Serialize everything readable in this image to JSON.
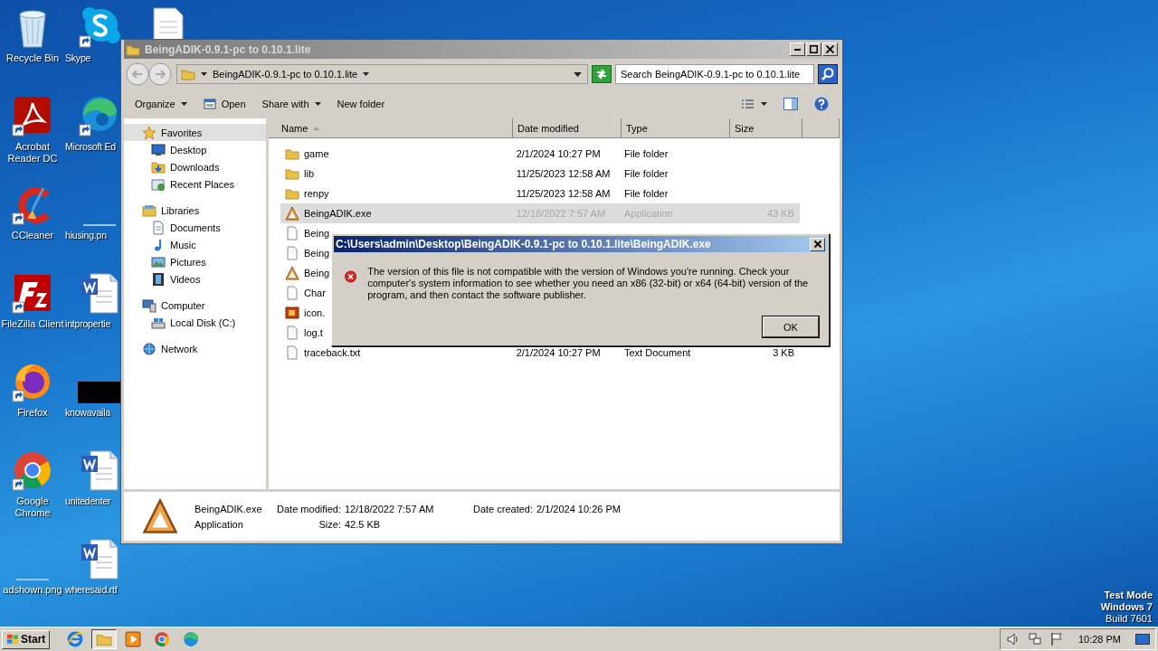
{
  "desktop": {
    "icons": [
      {
        "label": "Recycle Bin",
        "kind": "recycle",
        "shortcut": false
      },
      {
        "label": "Acrobat Reader DC",
        "kind": "acrobat",
        "shortcut": true
      },
      {
        "label": "CCleaner",
        "kind": "ccleaner",
        "shortcut": true
      },
      {
        "label": "FileZilla Client",
        "kind": "filezilla",
        "shortcut": true
      },
      {
        "label": "Firefox",
        "kind": "firefox",
        "shortcut": true
      },
      {
        "label": "Google Chrome",
        "kind": "chrome",
        "shortcut": true
      },
      {
        "label": "adshown.png",
        "kind": "blank"
      },
      {
        "label": "Skype",
        "kind": "skype",
        "shortcut": true
      },
      {
        "label": "Microsoft Ed",
        "kind": "edge",
        "shortcut": true
      },
      {
        "label": "hiusing.pn",
        "kind": "blank"
      },
      {
        "label": "intpropertie",
        "kind": "word",
        "shortcut": false
      },
      {
        "label": "knowavaila",
        "kind": "black"
      },
      {
        "label": "unitedenter",
        "kind": "word",
        "shortcut": false
      },
      {
        "label": "wheresaid.rtf",
        "kind": "word",
        "shortcut": false
      },
      {
        "kind": "page",
        "shortcut": false
      }
    ],
    "mode_text": [
      "Test Mode",
      "Windows 7",
      "Build 7601"
    ]
  },
  "explorer": {
    "title": "BeingADIK-0.9.1-pc to 0.10.1.lite",
    "active": false,
    "address": "BeingADIK-0.9.1-pc to 0.10.1.lite",
    "search": {
      "placeholder": "Search BeingADIK-0.9.1-pc to 0.10.1.lite"
    },
    "commands": [
      {
        "label": "Organize",
        "kind": "menu"
      },
      {
        "label": "Open",
        "kind": "open"
      },
      {
        "label": "Share with",
        "kind": "menu"
      },
      {
        "label": "New folder",
        "kind": "plain"
      }
    ],
    "nav": [
      {
        "label": "Favorites",
        "kind": "star",
        "selected": true,
        "children": [
          {
            "label": "Desktop",
            "kind": "desktop",
            "selected": false
          },
          {
            "label": "Downloads",
            "kind": "downloads",
            "selected": false
          },
          {
            "label": "Recent Places",
            "kind": "recent",
            "selected": false
          }
        ]
      },
      {
        "label": "Libraries",
        "kind": "library",
        "selected": false,
        "children": [
          {
            "label": "Documents",
            "kind": "documents",
            "selected": false
          },
          {
            "label": "Music",
            "kind": "music",
            "selected": false
          },
          {
            "label": "Pictures",
            "kind": "pictures",
            "selected": false
          },
          {
            "label": "Videos",
            "kind": "videos",
            "selected": false
          }
        ]
      },
      {
        "label": "Computer",
        "kind": "computer",
        "selected": false,
        "children": [
          {
            "label": "Local Disk (C:)",
            "kind": "disk",
            "selected": false
          }
        ]
      },
      {
        "label": "Network",
        "kind": "network",
        "selected": false
      }
    ],
    "columns": [
      "Name",
      "Date modified",
      "Type",
      "Size"
    ],
    "rows": [
      {
        "name": "game",
        "date_modified": "2/1/2024 10:27 PM",
        "type": "File folder",
        "kind": "folder",
        "selected": false
      },
      {
        "name": "lib",
        "date_modified": "11/25/2023 12:58 AM",
        "type": "File folder",
        "kind": "folder",
        "selected": false
      },
      {
        "name": "renpy",
        "date_modified": "11/25/2023 12:58 AM",
        "type": "File folder",
        "kind": "folder",
        "selected": false
      },
      {
        "name": "BeingADIK.exe",
        "date_modified": "12/18/2022 7:57 AM",
        "type": "Application",
        "size": "43 KB",
        "kind": "exe",
        "selected": true
      },
      {
        "name": "Being",
        "kind": "text",
        "selected": false
      },
      {
        "name": "Being",
        "kind": "text",
        "selected": false
      },
      {
        "name": "Being",
        "kind": "exe",
        "selected": false
      },
      {
        "name": "Char",
        "kind": "text",
        "selected": false
      },
      {
        "name": "icon.",
        "kind": "image",
        "selected": false
      },
      {
        "name": "log.t",
        "kind": "text",
        "selected": false
      },
      {
        "name": "traceback.txt",
        "date_modified": "2/1/2024 10:27 PM",
        "type": "Text Document",
        "size": "3 KB",
        "kind": "text",
        "selected": false
      }
    ],
    "details": {
      "name": "BeingADIK.exe",
      "type": "Application",
      "fields": [
        {
          "label": "Date modified:",
          "value": "12/18/2022 7:57 AM"
        },
        {
          "label": "Date created:",
          "value": "2/1/2024 10:26 PM"
        },
        {
          "label": "Size:",
          "value": "42.5 KB"
        }
      ]
    }
  },
  "dialog": {
    "title": "C:\\Users\\admin\\Desktop\\BeingADIK-0.9.1-pc to 0.10.1.lite\\BeingADIK.exe",
    "active": true,
    "message": "The version of this file is not compatible with the version of Windows you're running. Check your computer's system information to see whether you need an x86 (32-bit) or x64 (64-bit) version of the program, and then contact the software publisher.",
    "button": "OK"
  },
  "taskbar": {
    "start": "Start",
    "apps": [
      {
        "kind": "ie",
        "active": false
      },
      {
        "kind": "explorer",
        "active": true
      },
      {
        "kind": "media",
        "active": false
      },
      {
        "kind": "chrome",
        "active": false
      },
      {
        "kind": "edge",
        "active": false
      }
    ],
    "clock": "10:28 PM"
  }
}
